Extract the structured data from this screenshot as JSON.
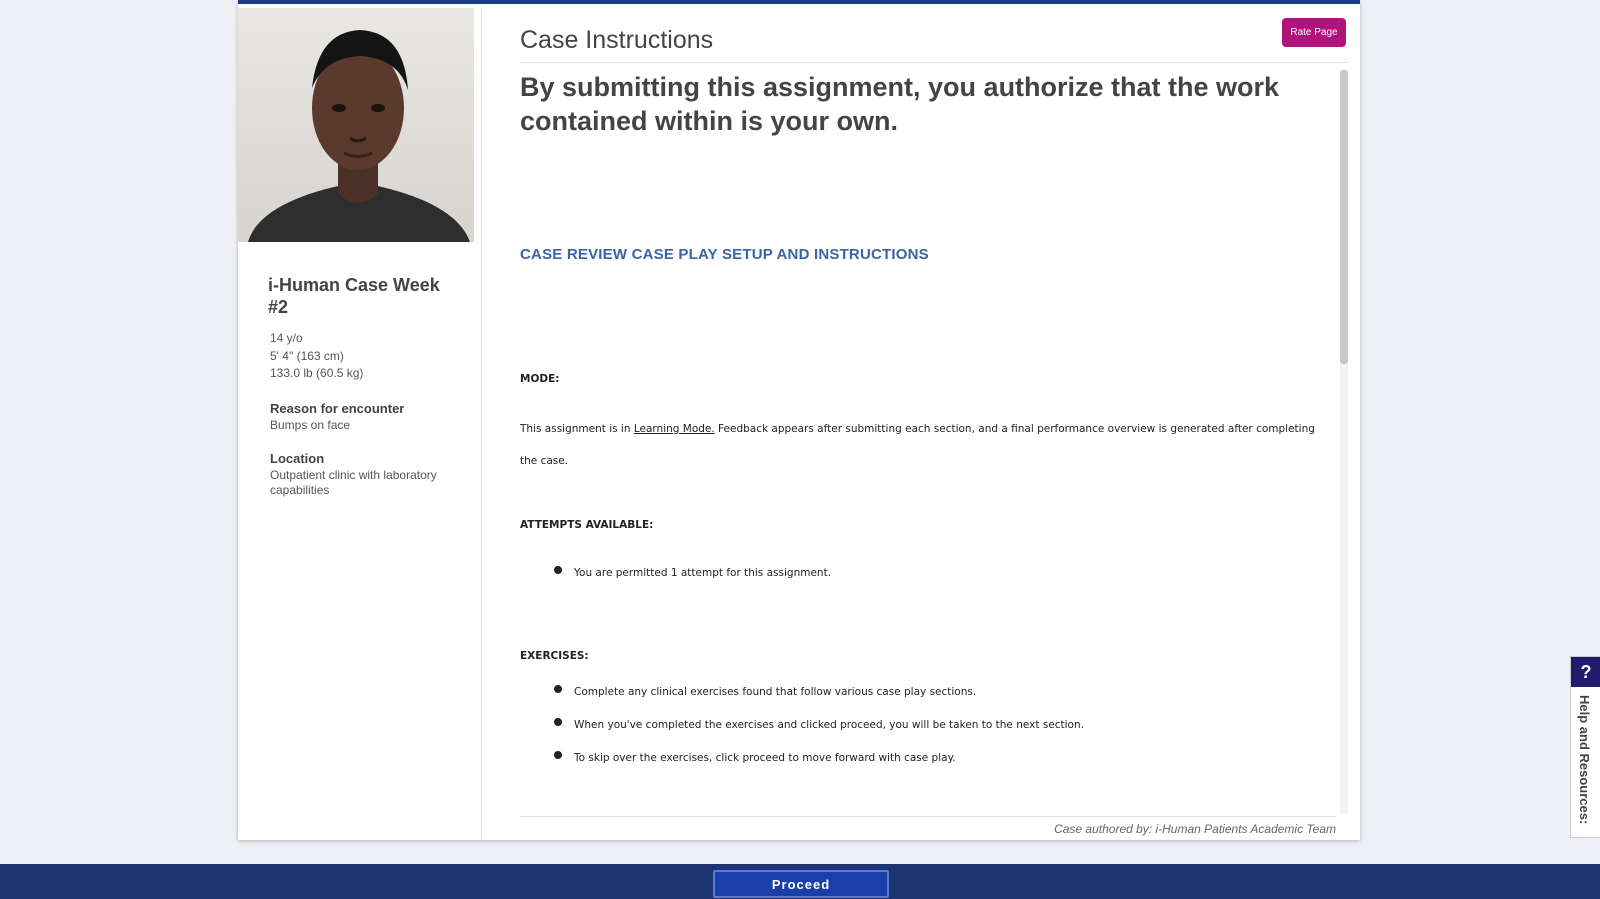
{
  "sidebar": {
    "patient_name": "i-Human Case Week #2",
    "age": "14 y/o",
    "height": "5' 4\" (163 cm)",
    "weight": "133.0 lb (60.5 kg)",
    "reason_label": "Reason for encounter",
    "reason_value": "Bumps on face",
    "location_label": "Location",
    "location_value": "Outpatient clinic with laboratory capabilities"
  },
  "main": {
    "title": "Case Instructions",
    "rate_button": "Rate Page",
    "authorization": "By submitting this assignment, you authorize that the work contained within is your own.",
    "case_heading": "CASE REVIEW CASE PLAY SETUP AND INSTRUCTIONS",
    "mode_label": "MODE:",
    "mode_text_before": "This assignment is in ",
    "mode_link": "Learning Mode.",
    "mode_text_after": " Feedback appears after submitting each section, and a final performance overview is generated after completing the case.",
    "attempts_label": "ATTEMPTS AVAILABLE:",
    "attempts_items": [
      "You are permitted 1 attempt for this assignment."
    ],
    "exercises_label": "EXERCISES:",
    "exercises_items": [
      "Complete any clinical exercises found that follow various case play sections.",
      "When you've completed the exercises and clicked proceed, you will be taken to the next section.",
      "To skip over the exercises, click proceed to move forward with case play."
    ],
    "credit": "Case authored by: i-Human Patients Academic Team"
  },
  "footer": {
    "proceed_label": "Proceed"
  },
  "help": {
    "icon_label": "?",
    "tab_label": "Help and Resources:"
  },
  "colors": {
    "accent": "#1a3c8c",
    "rate_button": "#b0147a",
    "heading": "#3b63a6",
    "footer": "#1c3471"
  }
}
